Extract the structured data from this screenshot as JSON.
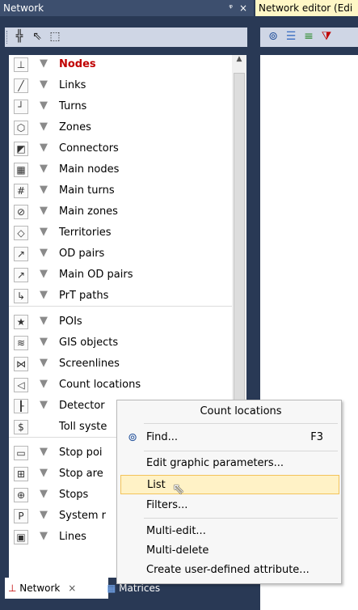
{
  "panel": {
    "title": "Network",
    "pin": "ᵠ",
    "close": "×",
    "toolbar_icons": [
      "add-icon",
      "pointer-icon",
      "select-rect-icon"
    ]
  },
  "items": [
    {
      "label": "Nodes",
      "icon": "nodes-icon",
      "glyph": "⊥",
      "selected": true
    },
    {
      "label": "Links",
      "icon": "links-icon",
      "glyph": "╱"
    },
    {
      "label": "Turns",
      "icon": "turns-icon",
      "glyph": "┘"
    },
    {
      "label": "Zones",
      "icon": "zones-icon",
      "glyph": "⬡"
    },
    {
      "label": "Connectors",
      "icon": "connectors-icon",
      "glyph": "◩"
    },
    {
      "label": "Main nodes",
      "icon": "main-nodes-icon",
      "glyph": "▦"
    },
    {
      "label": "Main turns",
      "icon": "main-turns-icon",
      "glyph": "#"
    },
    {
      "label": "Main zones",
      "icon": "main-zones-icon",
      "glyph": "⊘"
    },
    {
      "label": "Territories",
      "icon": "territories-icon",
      "glyph": "◇"
    },
    {
      "label": "OD pairs",
      "icon": "od-pairs-icon",
      "glyph": "↗"
    },
    {
      "label": "Main OD pairs",
      "icon": "main-od-pairs-icon",
      "glyph": "↗"
    },
    {
      "label": "PrT paths",
      "icon": "prt-paths-icon",
      "glyph": "↳"
    },
    {
      "label": "POIs",
      "icon": "pois-icon",
      "glyph": "★"
    },
    {
      "label": "GIS objects",
      "icon": "gis-objects-icon",
      "glyph": "≋"
    },
    {
      "label": "Screenlines",
      "icon": "screenlines-icon",
      "glyph": "⋈"
    },
    {
      "label": "Count locations",
      "icon": "count-locations-icon",
      "glyph": "◁"
    },
    {
      "label": "Detector",
      "icon": "detector-icon",
      "glyph": "┠"
    },
    {
      "label": "Toll syste",
      "icon": "toll-systems-icon",
      "glyph": "$",
      "no_filter": true
    },
    {
      "label": "Stop poi",
      "icon": "stop-points-icon",
      "glyph": "▭"
    },
    {
      "label": "Stop are",
      "icon": "stop-areas-icon",
      "glyph": "⊞"
    },
    {
      "label": "Stops",
      "icon": "stops-icon",
      "glyph": "⊕"
    },
    {
      "label": "System r",
      "icon": "system-routes-icon",
      "glyph": "P"
    },
    {
      "label": "Lines",
      "icon": "lines-icon",
      "glyph": "▣"
    }
  ],
  "tabs": {
    "network": "Network",
    "network_close": "×",
    "matrices": "Matrices"
  },
  "right": {
    "title": "Network editor (Edi"
  },
  "menu": {
    "title": "Count locations",
    "items": [
      {
        "label": "Find...",
        "accel": "F3",
        "icon": "binoculars-icon"
      },
      {
        "label": "Edit graphic parameters..."
      },
      {
        "label": "List",
        "hover": true
      },
      {
        "label": "Filters..."
      },
      {
        "label": "Multi-edit..."
      },
      {
        "label": "Multi-delete"
      },
      {
        "label": "Create user-defined attribute..."
      }
    ]
  }
}
